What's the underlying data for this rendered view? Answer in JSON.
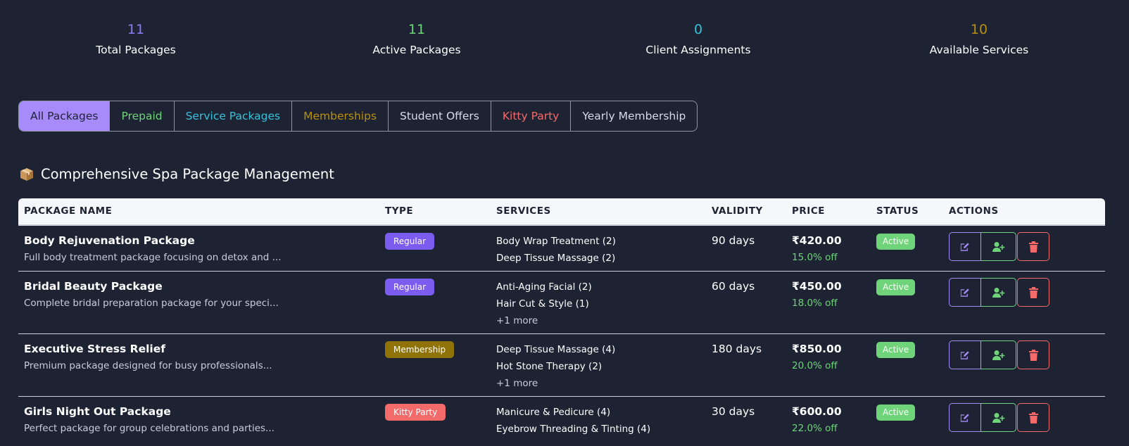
{
  "stats": [
    {
      "value": "11",
      "label": "Total Packages",
      "color": "#8b7cf6"
    },
    {
      "value": "11",
      "label": "Active Packages",
      "color": "#6fd37a"
    },
    {
      "value": "0",
      "label": "Client Assignments",
      "color": "#39c0d8"
    },
    {
      "value": "10",
      "label": "Available Services",
      "color": "#b8900f"
    }
  ],
  "tabs": [
    {
      "label": "All Packages",
      "color": "#1d2333",
      "active": true
    },
    {
      "label": "Prepaid",
      "color": "#6fd37a"
    },
    {
      "label": "Service Packages",
      "color": "#39c0d8"
    },
    {
      "label": "Memberships",
      "color": "#b8900f"
    },
    {
      "label": "Student Offers",
      "color": "#d6dbe5"
    },
    {
      "label": "Kitty Party",
      "color": "#f26a6a"
    },
    {
      "label": "Yearly Membership",
      "color": "#d6dbe5"
    }
  ],
  "section": {
    "icon": "package-icon",
    "title": "Comprehensive Spa Package Management"
  },
  "table": {
    "headers": {
      "name": "PACKAGE NAME",
      "type": "TYPE",
      "services": "SERVICES",
      "validity": "VALIDITY",
      "price": "PRICE",
      "status": "STATUS",
      "actions": "ACTIONS"
    },
    "rows": [
      {
        "name": "Body Rejuvenation Package",
        "desc": "Full body treatment package focusing on detox and ...",
        "type": "Regular",
        "type_color": "#7b5cf0",
        "services": [
          "Body Wrap Treatment (2)",
          "Deep Tissue Massage (2)"
        ],
        "more": "",
        "validity": "90 days",
        "price": "₹420.00",
        "discount": "15.0% off",
        "status": "Active"
      },
      {
        "name": "Bridal Beauty Package",
        "desc": "Complete bridal preparation package for your speci...",
        "type": "Regular",
        "type_color": "#7b5cf0",
        "services": [
          "Anti-Aging Facial (2)",
          "Hair Cut & Style (1)"
        ],
        "more": "+1 more",
        "validity": "60 days",
        "price": "₹450.00",
        "discount": "18.0% off",
        "status": "Active"
      },
      {
        "name": "Executive Stress Relief",
        "desc": "Premium package designed for busy professionals...",
        "type": "Membership",
        "type_color": "#8f7306",
        "services": [
          "Deep Tissue Massage (4)",
          "Hot Stone Therapy (2)"
        ],
        "more": "+1 more",
        "validity": "180 days",
        "price": "₹850.00",
        "discount": "20.0% off",
        "status": "Active"
      },
      {
        "name": "Girls Night Out Package",
        "desc": "Perfect package for group celebrations and parties...",
        "type": "Kitty Party",
        "type_color": "#f26a6a",
        "services": [
          "Manicure & Pedicure (4)",
          "Eyebrow Threading & Tinting (4)"
        ],
        "more": "",
        "validity": "30 days",
        "price": "₹600.00",
        "discount": "22.0% off",
        "status": "Active"
      }
    ]
  },
  "icons": {
    "edit": "edit-icon",
    "assign": "user-plus-icon",
    "delete": "trash-icon"
  }
}
